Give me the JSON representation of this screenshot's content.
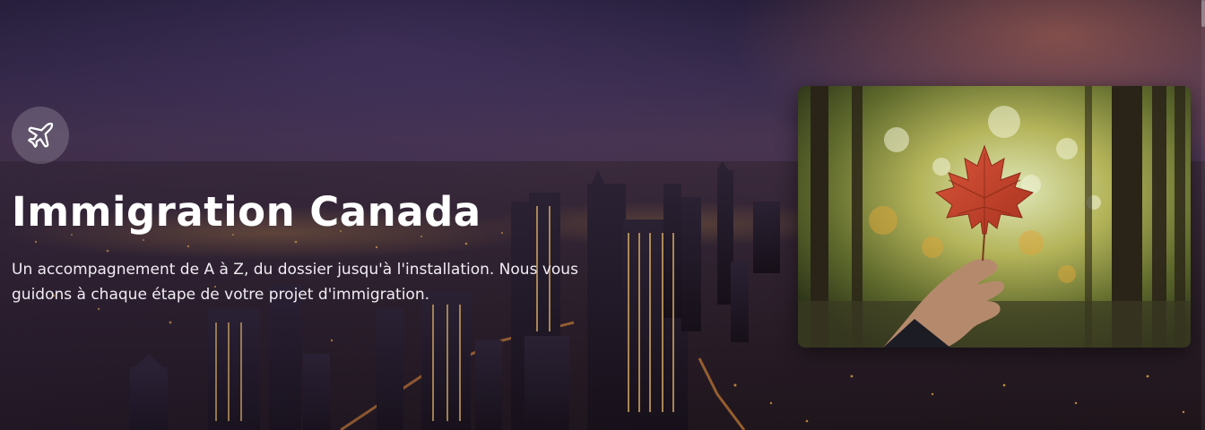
{
  "hero": {
    "icon": "airplane-icon",
    "title": "Immigration Canada",
    "description": "Un accompagnement de A à Z, du dossier jusqu'à l'installation. Nous vous guidons à chaque étape de votre projet d'immigration.",
    "image_icon": "maple-leaf-in-hand-photo"
  },
  "colors": {
    "title": "#ffffff",
    "text": "#f1edf3",
    "sky_dusk": "#4c3753",
    "city_lights": "#f2a13a",
    "leaf": "#c8472a"
  }
}
